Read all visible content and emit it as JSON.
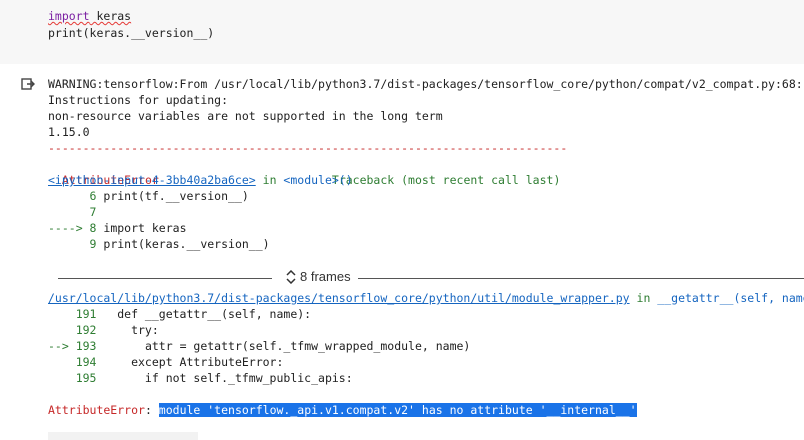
{
  "code_cell": {
    "line1_kw": "import",
    "line1_rest": " keras",
    "line2_pre": "print(",
    "line2_rest": "keras.__version__)"
  },
  "output": {
    "warning": "WARNING:tensorflow:From /usr/local/lib/python3.7/dist-packages/tensorflow_core/python/compat/v2_compat.py:68:",
    "instructions": "Instructions for updating:",
    "nonresource": "non-resource variables are not supported in the long term",
    "version": "1.15.0",
    "separator": "---------------------------------------------------------------------------",
    "error_name": "AttributeError",
    "traceback_label": "Traceback (most recent call last)",
    "input_link": "<ipython-input-4-3bb40a2ba6ce>",
    "in_word": " in ",
    "module_label": "<module>()",
    "tb_lines": [
      {
        "num": "      6 ",
        "arrow": "",
        "code": "print(tf.__version__)"
      },
      {
        "num": "      7",
        "arrow": "",
        "code": ""
      },
      {
        "num": " 8 ",
        "arrow": "---->",
        "code": "import keras"
      },
      {
        "num": "      9 ",
        "arrow": "",
        "code": "print(keras.__version__)"
      }
    ],
    "frames_label": "8 frames",
    "wrapper_path": "/usr/local/lib/python3.7/dist-packages/tensorflow_core/python/util/module_wrapper.py",
    "wrapper_in": " in ",
    "wrapper_func": "__getattr__(self, name)",
    "wrapper_lines": [
      {
        "num": "    191 ",
        "arrow": "",
        "code": "  def __getattr__(self, name):"
      },
      {
        "num": "    192 ",
        "arrow": "",
        "code": "    try:"
      },
      {
        "num": " 193 ",
        "arrow": "-->",
        "code": "      attr = getattr(self._tfmw_wrapped_module, name)"
      },
      {
        "num": "    194 ",
        "arrow": "",
        "code": "    except AttributeError:"
      },
      {
        "num": "    195 ",
        "arrow": "",
        "code": "      if not self._tfmw_public_apis:"
      }
    ],
    "final_error_name": "AttributeError",
    "final_error_sep": ": ",
    "final_error_msg": "module 'tensorflow._api.v1.compat.v2' has no attribute '__internal__'"
  }
}
